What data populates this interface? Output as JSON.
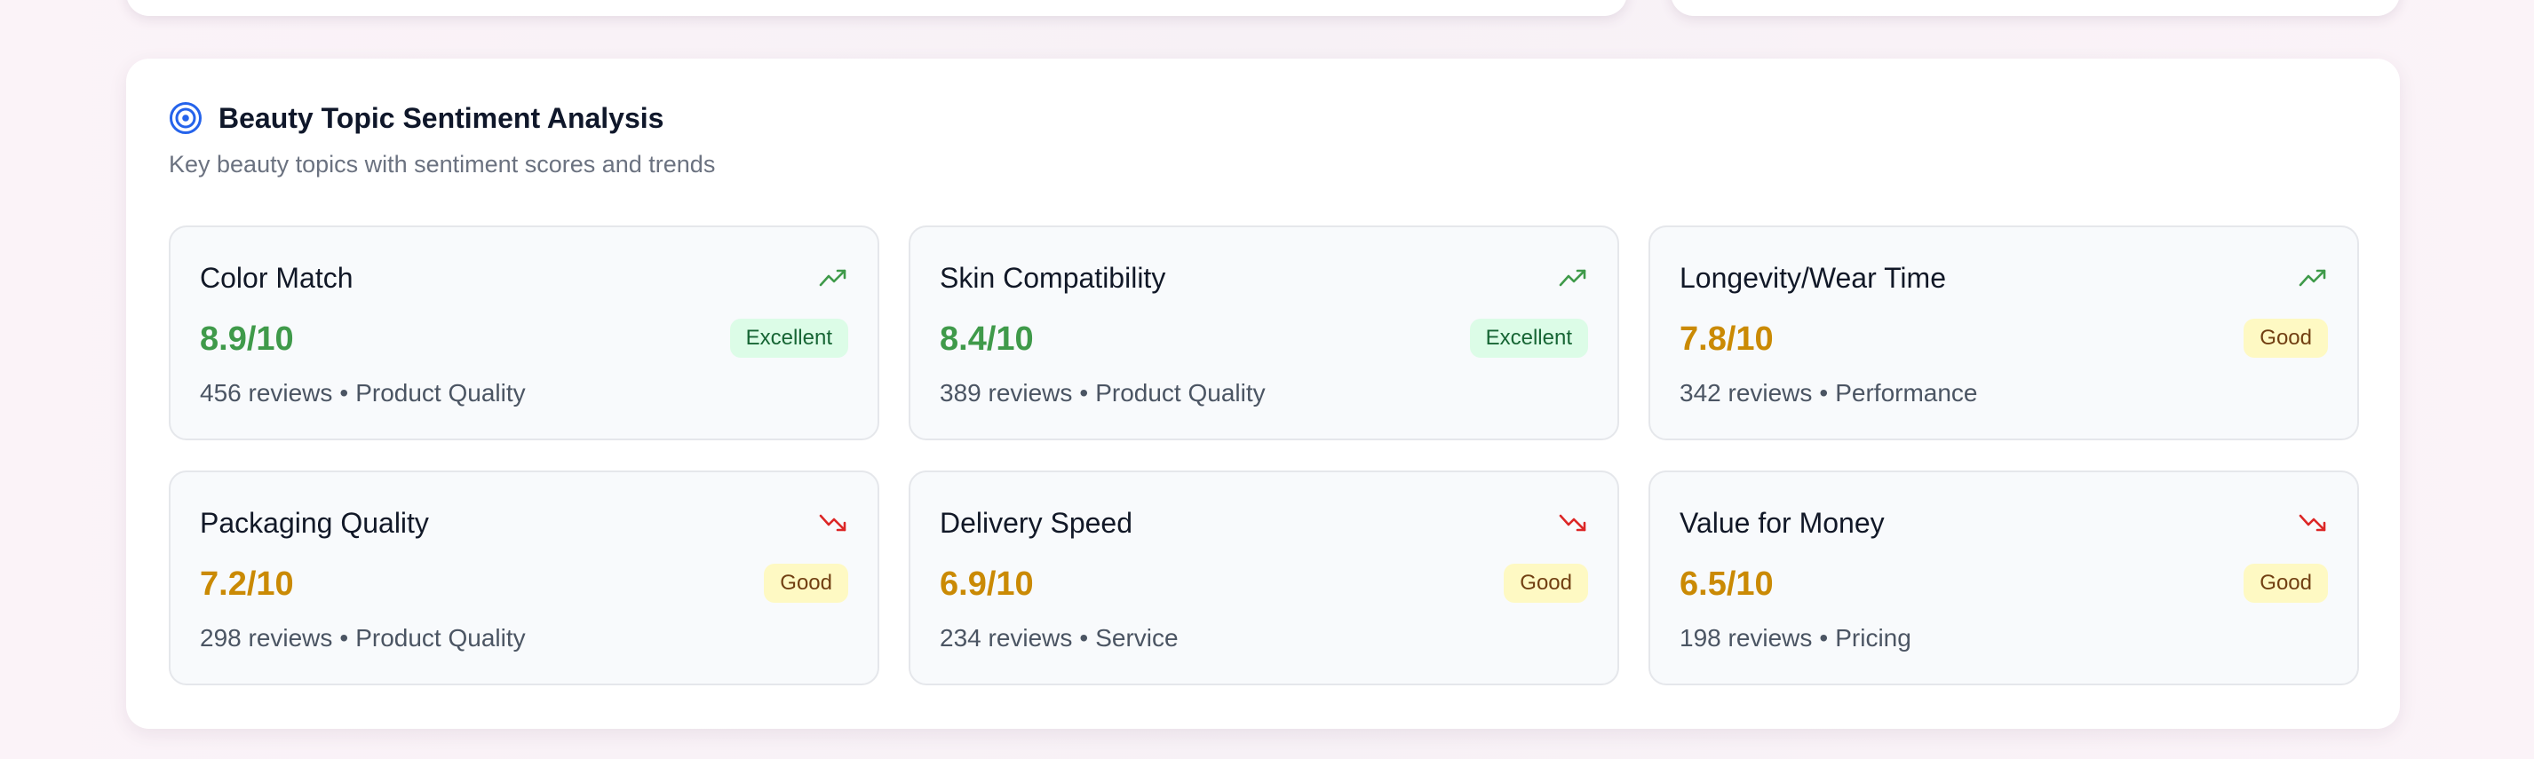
{
  "panel": {
    "title": "Beauty Topic Sentiment Analysis",
    "subtitle": "Key beauty topics with sentiment scores and trends",
    "icon": "target-icon",
    "icon_color": "#2563eb"
  },
  "colors": {
    "excellent_text": "#3f9a4a",
    "excellent_badge_bg": "#dcfce7",
    "excellent_badge_text": "#166534",
    "good_text": "#ca8a04",
    "good_badge_bg": "#fef9c3",
    "good_badge_text": "#713f12",
    "trend_up": "#3f9a4a",
    "trend_down": "#dc2626"
  },
  "topics": [
    {
      "name": "Color Match",
      "score": "8.9/10",
      "rating": "Excellent",
      "reviews": "456 reviews",
      "category": "Product Quality",
      "trend": "up"
    },
    {
      "name": "Skin Compatibility",
      "score": "8.4/10",
      "rating": "Excellent",
      "reviews": "389 reviews",
      "category": "Product Quality",
      "trend": "up"
    },
    {
      "name": "Longevity/Wear Time",
      "score": "7.8/10",
      "rating": "Good",
      "reviews": "342 reviews",
      "category": "Performance",
      "trend": "up"
    },
    {
      "name": "Packaging Quality",
      "score": "7.2/10",
      "rating": "Good",
      "reviews": "298 reviews",
      "category": "Product Quality",
      "trend": "down"
    },
    {
      "name": "Delivery Speed",
      "score": "6.9/10",
      "rating": "Good",
      "reviews": "234 reviews",
      "category": "Service",
      "trend": "down"
    },
    {
      "name": "Value for Money",
      "score": "6.5/10",
      "rating": "Good",
      "reviews": "198 reviews",
      "category": "Pricing",
      "trend": "down"
    }
  ]
}
